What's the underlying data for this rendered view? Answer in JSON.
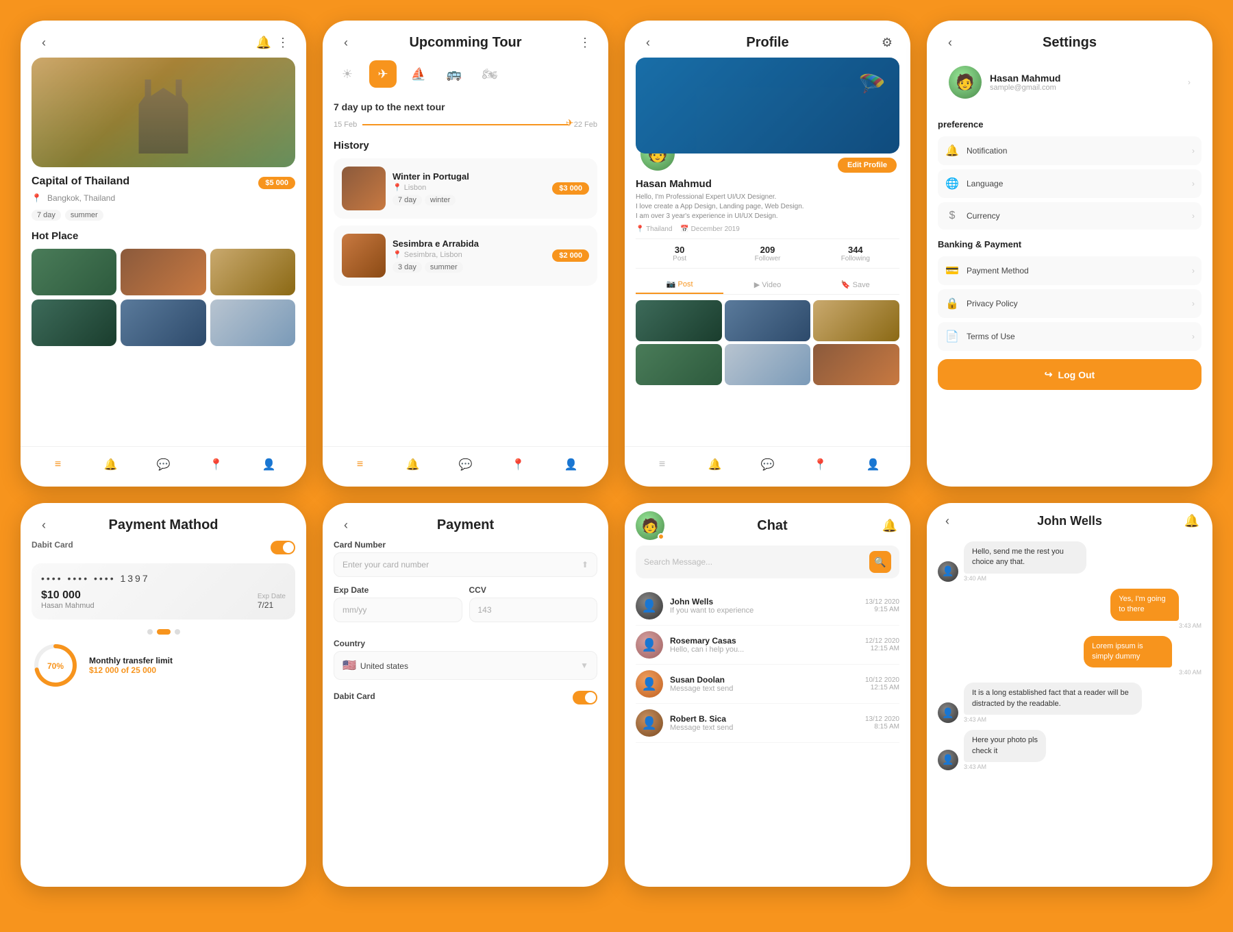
{
  "bg_color": "#F7941D",
  "phones": [
    {
      "id": "destination",
      "header": {
        "back": "‹",
        "title": "",
        "notif": "🔔",
        "more": "⋮"
      },
      "hero": {
        "alt": "Capital of Thailand"
      },
      "destination_name": "Capital of Thailand",
      "location": "Bangkok, Thailand",
      "price": "$5 000",
      "tags": [
        "7 day",
        "summer"
      ],
      "hot_place_title": "Hot Place",
      "footer_icons": [
        "≡",
        "🔔",
        "💬",
        "📍",
        "👤"
      ]
    },
    {
      "id": "tour",
      "header": {
        "back": "‹",
        "title": "Upcomming Tour",
        "more": "⋮"
      },
      "transport_tabs": [
        "☀",
        "✈",
        "⛵",
        "🚌",
        "🏍"
      ],
      "active_tab": 1,
      "tour_info": "7 day up to the next tour",
      "date_from": "15 Feb",
      "date_to": "22 Feb",
      "history_title": "History",
      "history": [
        {
          "name": "Winter in Portugal",
          "location": "Lisbon",
          "tags": [
            "7 day",
            "winter"
          ],
          "price": "$3 000"
        },
        {
          "name": "Sesimbra e Arrabida",
          "location": "Sesimbra, Lisbon",
          "tags": [
            "3 day",
            "summer"
          ],
          "price": "$2 000"
        }
      ],
      "footer_icons": [
        "≡",
        "🔔",
        "💬",
        "📍",
        "👤"
      ]
    },
    {
      "id": "profile",
      "header": {
        "back": "‹",
        "title": "Profile",
        "gear": "⚙"
      },
      "user_name": "Hasan Mahmud",
      "bio": "Hello, I'm Professional Expert UI/UX Designer.\nI love create a App Design, Landing page, Web Design.\nI am over 3 year's experience in UI/UX Design.",
      "location": "Thailand",
      "joined": "December 2019",
      "edit_btn": "Edit Profile",
      "stats": [
        {
          "value": "30",
          "label": "Post"
        },
        {
          "value": "209",
          "label": "Follower"
        },
        {
          "value": "344",
          "label": "Following"
        }
      ],
      "tabs": [
        "Post",
        "Video",
        "Save"
      ],
      "footer_icons": [
        "≡",
        "🔔",
        "💬",
        "📍",
        "👤"
      ]
    },
    {
      "id": "settings",
      "header": {
        "back": "‹",
        "title": "Settings"
      },
      "user": {
        "name": "Hasan Mahmud",
        "email": "sample@gmail.com"
      },
      "sections": [
        {
          "title": "preference",
          "items": [
            {
              "icon": "🔔",
              "label": "Notification"
            },
            {
              "icon": "🌐",
              "label": "Language"
            },
            {
              "icon": "$",
              "label": "Currency"
            }
          ]
        },
        {
          "title": "Banking & Payment",
          "items": [
            {
              "icon": "💳",
              "label": "Payment Method"
            },
            {
              "icon": "🔒",
              "label": "Privacy Policy"
            },
            {
              "icon": "📄",
              "label": "Terms of Use"
            }
          ]
        }
      ],
      "logout_btn": "Log Out"
    }
  ],
  "bottom_phones": [
    {
      "id": "payment-method",
      "header": {
        "back": "‹",
        "title": "Payment Mathod"
      },
      "card": {
        "type": "Dabit Card",
        "number": "••••  ••••  ••••  1397",
        "amount": "$10 000",
        "holder": "Hasan Mahmud",
        "exp_label": "Exp Date",
        "exp": "7/21"
      },
      "toggle_state": "on",
      "transfer": {
        "title": "Monthly transfer limit",
        "percent": 70,
        "current": "$12 000",
        "total": "25 000"
      }
    },
    {
      "id": "payment",
      "header": {
        "back": "‹",
        "title": "Payment"
      },
      "form": {
        "card_number_label": "Card Number",
        "card_number_placeholder": "Enter your card number",
        "exp_label": "Exp Date",
        "exp_placeholder": "mm/yy",
        "ccv_label": "CCV",
        "ccv_placeholder": "143",
        "country_label": "Country",
        "country_value": "United states",
        "debit_label": "Dabit Card"
      }
    },
    {
      "id": "chat",
      "header": {
        "title": "Chat",
        "notif": "🔔"
      },
      "search_placeholder": "Search Message...",
      "contacts": [
        {
          "name": "John Wells",
          "msg": "If you want to experience",
          "date": "13/12 2020",
          "time": "9:15 AM"
        },
        {
          "name": "Rosemary Casas",
          "msg": "Hello, can i help you...",
          "date": "12/12 2020",
          "time": "12:15 AM"
        },
        {
          "name": "Susan Doolan",
          "msg": "Message text send",
          "date": "10/12 2020",
          "time": "12:15 AM"
        },
        {
          "name": "Robert B. Sica",
          "msg": "Message text send",
          "date": "13/12 2020",
          "time": "8:15 AM"
        }
      ]
    },
    {
      "id": "convo",
      "header": {
        "back": "‹",
        "title": "John Wells",
        "notif": "🔔"
      },
      "messages": [
        {
          "side": "left",
          "text": "Hello, send me the rest you choice any that.",
          "time": "3:40 AM"
        },
        {
          "side": "right",
          "text": "Yes, I'm going to there",
          "time": "3:43 AM"
        },
        {
          "side": "right",
          "text": "Lorem ipsum is simply dummy",
          "time": "3:40 AM"
        },
        {
          "side": "left",
          "text": "It is a long established fact that a reader will be distracted by the readable.",
          "time": "3:43 AM"
        },
        {
          "side": "left",
          "text": "Here your photo pls check it",
          "time": "3:43 AM"
        }
      ]
    }
  ]
}
